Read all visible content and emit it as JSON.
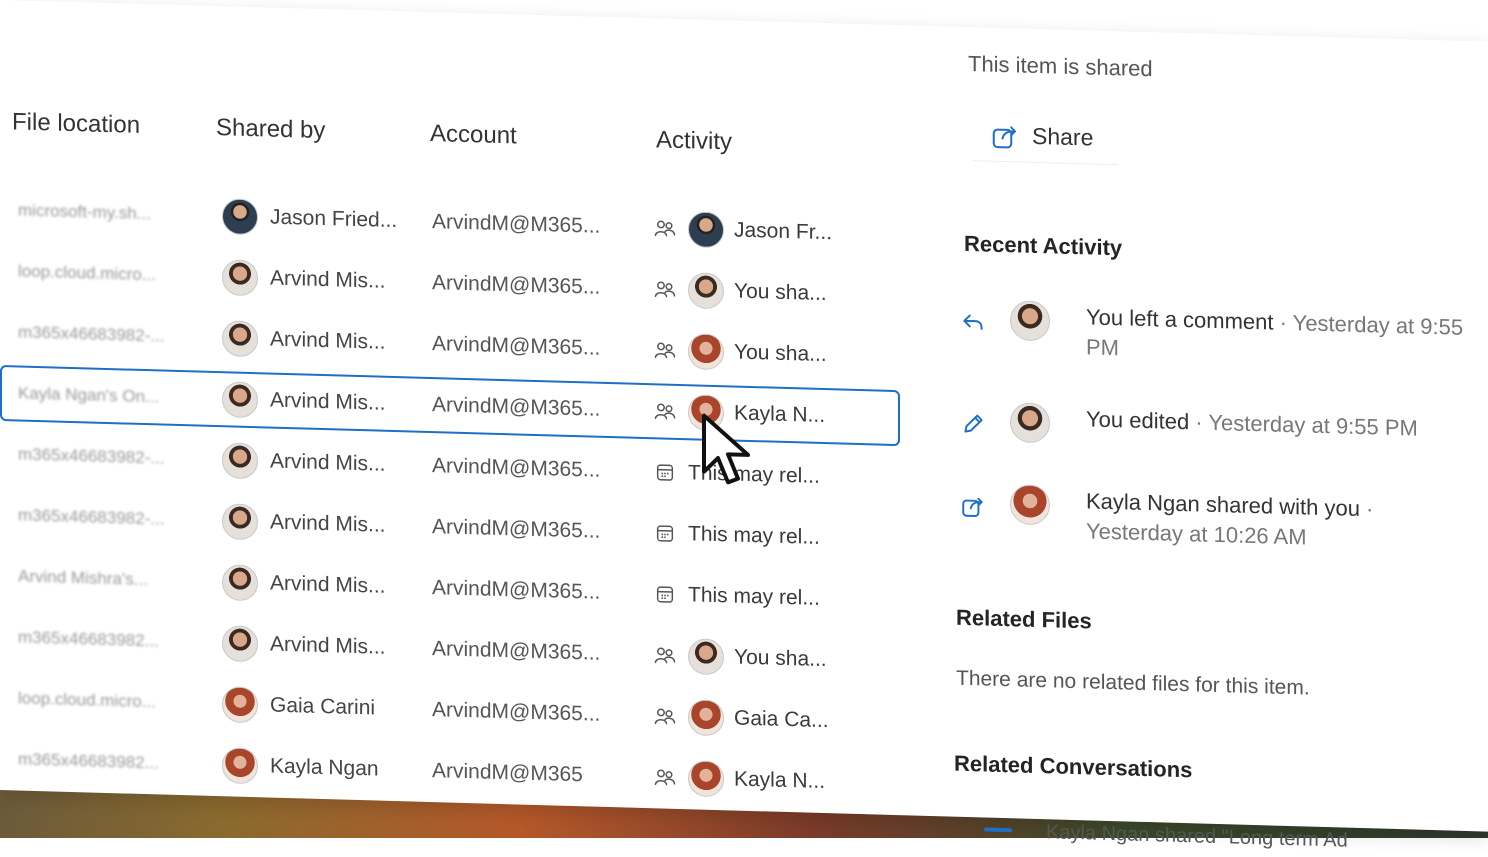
{
  "columns": {
    "location": "File location",
    "shared_by": "Shared by",
    "account": "Account",
    "activity": "Activity"
  },
  "rows": [
    {
      "location": "microsoft-my.sh...",
      "shared_by": "Jason Fried...",
      "account": "ArvindM@M365...",
      "activity": "Jason Fr...",
      "activity_icon": "people-icon",
      "avatar": "suit",
      "act_avatar": "suit"
    },
    {
      "location": "loop.cloud.micro...",
      "shared_by": "Arvind Mis...",
      "account": "ArvindM@M365...",
      "activity": "You sha...",
      "activity_icon": "people-icon",
      "avatar": "male",
      "act_avatar": "male"
    },
    {
      "location": "m365x46683982-...",
      "shared_by": "Arvind Mis...",
      "account": "ArvindM@M365...",
      "activity": "You sha...",
      "activity_icon": "people-icon",
      "avatar": "male",
      "act_avatar": "female"
    },
    {
      "location": "Kayla Ngan's On...",
      "shared_by": "Arvind Mis...",
      "account": "ArvindM@M365...",
      "activity": "Kayla N...",
      "activity_icon": "people-icon",
      "avatar": "male",
      "act_avatar": "female",
      "selected": true
    },
    {
      "location": "m365x46683982-...",
      "shared_by": "Arvind Mis...",
      "account": "ArvindM@M365...",
      "activity": "This may rel...",
      "activity_icon": "calendar-icon",
      "avatar": "male"
    },
    {
      "location": "m365x46683982-...",
      "shared_by": "Arvind Mis...",
      "account": "ArvindM@M365...",
      "activity": "This may rel...",
      "activity_icon": "calendar-icon",
      "avatar": "male"
    },
    {
      "location": "Arvind Mishra's...",
      "shared_by": "Arvind Mis...",
      "account": "ArvindM@M365...",
      "activity": "This may rel...",
      "activity_icon": "calendar-icon",
      "avatar": "male"
    },
    {
      "location": "m365x46683982...",
      "shared_by": "Arvind Mis...",
      "account": "ArvindM@M365...",
      "activity": "You sha...",
      "activity_icon": "people-icon",
      "avatar": "male",
      "act_avatar": "male"
    },
    {
      "location": "loop.cloud.micro...",
      "shared_by": "Gaia Carini",
      "account": "ArvindM@M365...",
      "activity": "Gaia Ca...",
      "activity_icon": "people-icon",
      "avatar": "female",
      "act_avatar": "female"
    },
    {
      "location": "m365x46683982...",
      "shared_by": "Kayla Ngan",
      "account": "ArvindM@M365",
      "activity": "Kayla N...",
      "activity_icon": "people-icon",
      "avatar": "female",
      "act_avatar": "female"
    }
  ],
  "pane": {
    "shared_note": "This item is shared",
    "share_label": "Share",
    "recent_title": "Recent Activity",
    "activities": [
      {
        "icon": "reply-icon",
        "main": "You left a comment",
        "time": " · Yesterday at 9:55 PM"
      },
      {
        "icon": "pencil-icon",
        "main": "You edited",
        "time": " · Yesterday at 9:55 PM"
      },
      {
        "icon": "share-icon",
        "main": "Kayla Ngan shared with you",
        "time": " · Yesterday at 10:26 AM"
      }
    ],
    "related_files_title": "Related Files",
    "related_files_empty": "There are no related files for this item.",
    "related_conversations_title": "Related Conversations",
    "conversation_preview": "Kayla Ngan shared \"Long term Ad"
  },
  "colors": {
    "accent": "#1f6fc5"
  }
}
